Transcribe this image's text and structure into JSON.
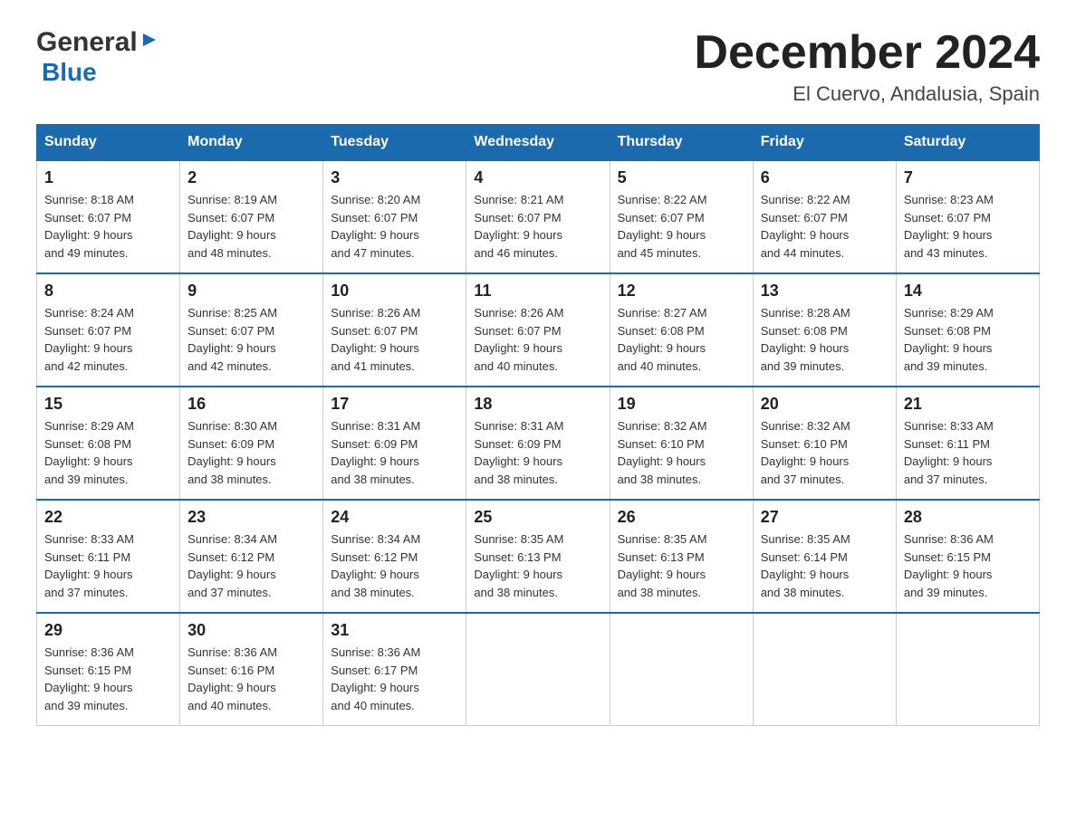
{
  "header": {
    "logo_general": "General",
    "logo_blue": "Blue",
    "month_title": "December 2024",
    "location": "El Cuervo, Andalusia, Spain"
  },
  "days_of_week": [
    "Sunday",
    "Monday",
    "Tuesday",
    "Wednesday",
    "Thursday",
    "Friday",
    "Saturday"
  ],
  "weeks": [
    [
      {
        "day": "1",
        "sunrise": "8:18 AM",
        "sunset": "6:07 PM",
        "daylight": "9 hours and 49 minutes."
      },
      {
        "day": "2",
        "sunrise": "8:19 AM",
        "sunset": "6:07 PM",
        "daylight": "9 hours and 48 minutes."
      },
      {
        "day": "3",
        "sunrise": "8:20 AM",
        "sunset": "6:07 PM",
        "daylight": "9 hours and 47 minutes."
      },
      {
        "day": "4",
        "sunrise": "8:21 AM",
        "sunset": "6:07 PM",
        "daylight": "9 hours and 46 minutes."
      },
      {
        "day": "5",
        "sunrise": "8:22 AM",
        "sunset": "6:07 PM",
        "daylight": "9 hours and 45 minutes."
      },
      {
        "day": "6",
        "sunrise": "8:22 AM",
        "sunset": "6:07 PM",
        "daylight": "9 hours and 44 minutes."
      },
      {
        "day": "7",
        "sunrise": "8:23 AM",
        "sunset": "6:07 PM",
        "daylight": "9 hours and 43 minutes."
      }
    ],
    [
      {
        "day": "8",
        "sunrise": "8:24 AM",
        "sunset": "6:07 PM",
        "daylight": "9 hours and 42 minutes."
      },
      {
        "day": "9",
        "sunrise": "8:25 AM",
        "sunset": "6:07 PM",
        "daylight": "9 hours and 42 minutes."
      },
      {
        "day": "10",
        "sunrise": "8:26 AM",
        "sunset": "6:07 PM",
        "daylight": "9 hours and 41 minutes."
      },
      {
        "day": "11",
        "sunrise": "8:26 AM",
        "sunset": "6:07 PM",
        "daylight": "9 hours and 40 minutes."
      },
      {
        "day": "12",
        "sunrise": "8:27 AM",
        "sunset": "6:08 PM",
        "daylight": "9 hours and 40 minutes."
      },
      {
        "day": "13",
        "sunrise": "8:28 AM",
        "sunset": "6:08 PM",
        "daylight": "9 hours and 39 minutes."
      },
      {
        "day": "14",
        "sunrise": "8:29 AM",
        "sunset": "6:08 PM",
        "daylight": "9 hours and 39 minutes."
      }
    ],
    [
      {
        "day": "15",
        "sunrise": "8:29 AM",
        "sunset": "6:08 PM",
        "daylight": "9 hours and 39 minutes."
      },
      {
        "day": "16",
        "sunrise": "8:30 AM",
        "sunset": "6:09 PM",
        "daylight": "9 hours and 38 minutes."
      },
      {
        "day": "17",
        "sunrise": "8:31 AM",
        "sunset": "6:09 PM",
        "daylight": "9 hours and 38 minutes."
      },
      {
        "day": "18",
        "sunrise": "8:31 AM",
        "sunset": "6:09 PM",
        "daylight": "9 hours and 38 minutes."
      },
      {
        "day": "19",
        "sunrise": "8:32 AM",
        "sunset": "6:10 PM",
        "daylight": "9 hours and 38 minutes."
      },
      {
        "day": "20",
        "sunrise": "8:32 AM",
        "sunset": "6:10 PM",
        "daylight": "9 hours and 37 minutes."
      },
      {
        "day": "21",
        "sunrise": "8:33 AM",
        "sunset": "6:11 PM",
        "daylight": "9 hours and 37 minutes."
      }
    ],
    [
      {
        "day": "22",
        "sunrise": "8:33 AM",
        "sunset": "6:11 PM",
        "daylight": "9 hours and 37 minutes."
      },
      {
        "day": "23",
        "sunrise": "8:34 AM",
        "sunset": "6:12 PM",
        "daylight": "9 hours and 37 minutes."
      },
      {
        "day": "24",
        "sunrise": "8:34 AM",
        "sunset": "6:12 PM",
        "daylight": "9 hours and 38 minutes."
      },
      {
        "day": "25",
        "sunrise": "8:35 AM",
        "sunset": "6:13 PM",
        "daylight": "9 hours and 38 minutes."
      },
      {
        "day": "26",
        "sunrise": "8:35 AM",
        "sunset": "6:13 PM",
        "daylight": "9 hours and 38 minutes."
      },
      {
        "day": "27",
        "sunrise": "8:35 AM",
        "sunset": "6:14 PM",
        "daylight": "9 hours and 38 minutes."
      },
      {
        "day": "28",
        "sunrise": "8:36 AM",
        "sunset": "6:15 PM",
        "daylight": "9 hours and 39 minutes."
      }
    ],
    [
      {
        "day": "29",
        "sunrise": "8:36 AM",
        "sunset": "6:15 PM",
        "daylight": "9 hours and 39 minutes."
      },
      {
        "day": "30",
        "sunrise": "8:36 AM",
        "sunset": "6:16 PM",
        "daylight": "9 hours and 40 minutes."
      },
      {
        "day": "31",
        "sunrise": "8:36 AM",
        "sunset": "6:17 PM",
        "daylight": "9 hours and 40 minutes."
      },
      null,
      null,
      null,
      null
    ]
  ],
  "labels": {
    "sunrise": "Sunrise:",
    "sunset": "Sunset:",
    "daylight": "Daylight:"
  }
}
